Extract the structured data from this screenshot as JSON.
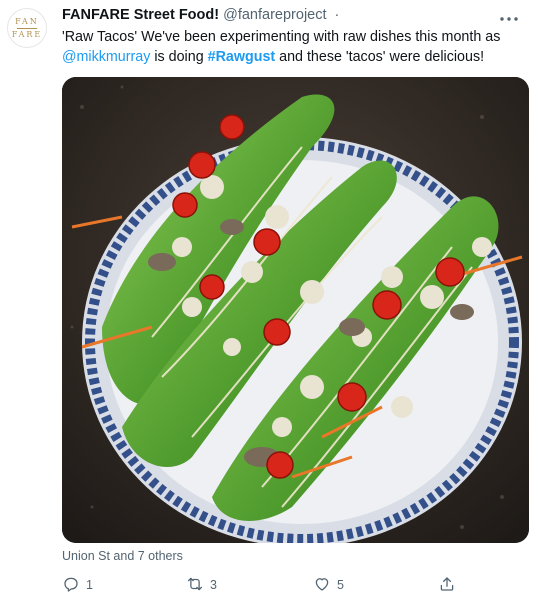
{
  "tweet": {
    "avatar_lines": [
      "FAN",
      "FARE"
    ],
    "display_name": "FANFARE Street Food!",
    "handle": "@fanfareproject",
    "separator": "·",
    "more_icon": "more-horizontal-icon",
    "text_part1": "'Raw Tacos' We've been experimenting with raw dishes this month as",
    "mention": "@mikkmurray",
    "text_part2": " is doing ",
    "hashtag": "#Rawgust",
    "text_part3": " and these 'tacos' were delicious!",
    "tagged_people": "Union St and 7 others"
  },
  "actions": {
    "reply": {
      "icon": "reply-icon",
      "count": "1"
    },
    "retweet": {
      "icon": "retweet-icon",
      "count": "3"
    },
    "like": {
      "icon": "like-heart-icon",
      "count": "5"
    },
    "share": {
      "icon": "share-icon"
    }
  },
  "colors": {
    "link": "#1d9bf0",
    "secondary_text": "#536471",
    "primary_text": "#0f1419",
    "logo_gold": "#b19150"
  }
}
